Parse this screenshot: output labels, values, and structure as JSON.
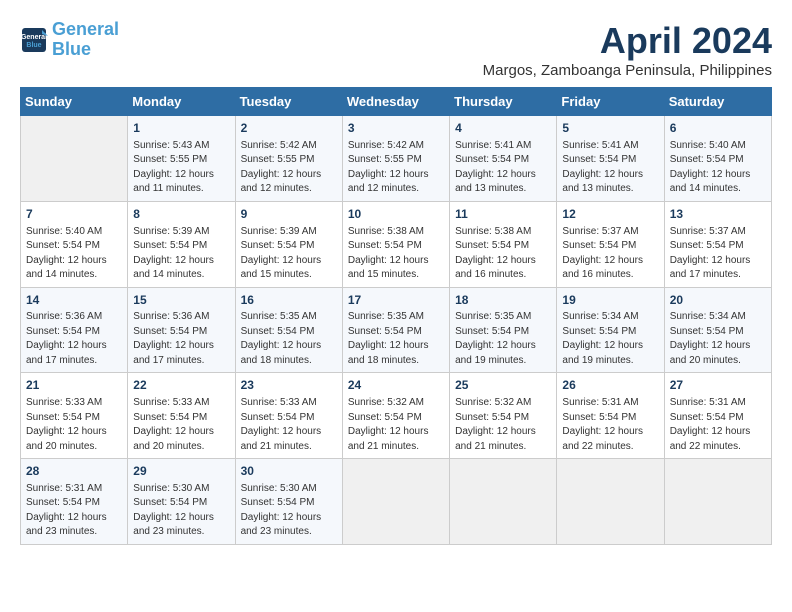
{
  "header": {
    "logo_line1": "General",
    "logo_line2": "Blue",
    "month_year": "April 2024",
    "location": "Margos, Zamboanga Peninsula, Philippines"
  },
  "weekdays": [
    "Sunday",
    "Monday",
    "Tuesday",
    "Wednesday",
    "Thursday",
    "Friday",
    "Saturday"
  ],
  "weeks": [
    [
      {
        "day": "",
        "info": ""
      },
      {
        "day": "1",
        "info": "Sunrise: 5:43 AM\nSunset: 5:55 PM\nDaylight: 12 hours\nand 11 minutes."
      },
      {
        "day": "2",
        "info": "Sunrise: 5:42 AM\nSunset: 5:55 PM\nDaylight: 12 hours\nand 12 minutes."
      },
      {
        "day": "3",
        "info": "Sunrise: 5:42 AM\nSunset: 5:55 PM\nDaylight: 12 hours\nand 12 minutes."
      },
      {
        "day": "4",
        "info": "Sunrise: 5:41 AM\nSunset: 5:54 PM\nDaylight: 12 hours\nand 13 minutes."
      },
      {
        "day": "5",
        "info": "Sunrise: 5:41 AM\nSunset: 5:54 PM\nDaylight: 12 hours\nand 13 minutes."
      },
      {
        "day": "6",
        "info": "Sunrise: 5:40 AM\nSunset: 5:54 PM\nDaylight: 12 hours\nand 14 minutes."
      }
    ],
    [
      {
        "day": "7",
        "info": "Sunrise: 5:40 AM\nSunset: 5:54 PM\nDaylight: 12 hours\nand 14 minutes."
      },
      {
        "day": "8",
        "info": "Sunrise: 5:39 AM\nSunset: 5:54 PM\nDaylight: 12 hours\nand 14 minutes."
      },
      {
        "day": "9",
        "info": "Sunrise: 5:39 AM\nSunset: 5:54 PM\nDaylight: 12 hours\nand 15 minutes."
      },
      {
        "day": "10",
        "info": "Sunrise: 5:38 AM\nSunset: 5:54 PM\nDaylight: 12 hours\nand 15 minutes."
      },
      {
        "day": "11",
        "info": "Sunrise: 5:38 AM\nSunset: 5:54 PM\nDaylight: 12 hours\nand 16 minutes."
      },
      {
        "day": "12",
        "info": "Sunrise: 5:37 AM\nSunset: 5:54 PM\nDaylight: 12 hours\nand 16 minutes."
      },
      {
        "day": "13",
        "info": "Sunrise: 5:37 AM\nSunset: 5:54 PM\nDaylight: 12 hours\nand 17 minutes."
      }
    ],
    [
      {
        "day": "14",
        "info": "Sunrise: 5:36 AM\nSunset: 5:54 PM\nDaylight: 12 hours\nand 17 minutes."
      },
      {
        "day": "15",
        "info": "Sunrise: 5:36 AM\nSunset: 5:54 PM\nDaylight: 12 hours\nand 17 minutes."
      },
      {
        "day": "16",
        "info": "Sunrise: 5:35 AM\nSunset: 5:54 PM\nDaylight: 12 hours\nand 18 minutes."
      },
      {
        "day": "17",
        "info": "Sunrise: 5:35 AM\nSunset: 5:54 PM\nDaylight: 12 hours\nand 18 minutes."
      },
      {
        "day": "18",
        "info": "Sunrise: 5:35 AM\nSunset: 5:54 PM\nDaylight: 12 hours\nand 19 minutes."
      },
      {
        "day": "19",
        "info": "Sunrise: 5:34 AM\nSunset: 5:54 PM\nDaylight: 12 hours\nand 19 minutes."
      },
      {
        "day": "20",
        "info": "Sunrise: 5:34 AM\nSunset: 5:54 PM\nDaylight: 12 hours\nand 20 minutes."
      }
    ],
    [
      {
        "day": "21",
        "info": "Sunrise: 5:33 AM\nSunset: 5:54 PM\nDaylight: 12 hours\nand 20 minutes."
      },
      {
        "day": "22",
        "info": "Sunrise: 5:33 AM\nSunset: 5:54 PM\nDaylight: 12 hours\nand 20 minutes."
      },
      {
        "day": "23",
        "info": "Sunrise: 5:33 AM\nSunset: 5:54 PM\nDaylight: 12 hours\nand 21 minutes."
      },
      {
        "day": "24",
        "info": "Sunrise: 5:32 AM\nSunset: 5:54 PM\nDaylight: 12 hours\nand 21 minutes."
      },
      {
        "day": "25",
        "info": "Sunrise: 5:32 AM\nSunset: 5:54 PM\nDaylight: 12 hours\nand 21 minutes."
      },
      {
        "day": "26",
        "info": "Sunrise: 5:31 AM\nSunset: 5:54 PM\nDaylight: 12 hours\nand 22 minutes."
      },
      {
        "day": "27",
        "info": "Sunrise: 5:31 AM\nSunset: 5:54 PM\nDaylight: 12 hours\nand 22 minutes."
      }
    ],
    [
      {
        "day": "28",
        "info": "Sunrise: 5:31 AM\nSunset: 5:54 PM\nDaylight: 12 hours\nand 23 minutes."
      },
      {
        "day": "29",
        "info": "Sunrise: 5:30 AM\nSunset: 5:54 PM\nDaylight: 12 hours\nand 23 minutes."
      },
      {
        "day": "30",
        "info": "Sunrise: 5:30 AM\nSunset: 5:54 PM\nDaylight: 12 hours\nand 23 minutes."
      },
      {
        "day": "",
        "info": ""
      },
      {
        "day": "",
        "info": ""
      },
      {
        "day": "",
        "info": ""
      },
      {
        "day": "",
        "info": ""
      }
    ]
  ]
}
